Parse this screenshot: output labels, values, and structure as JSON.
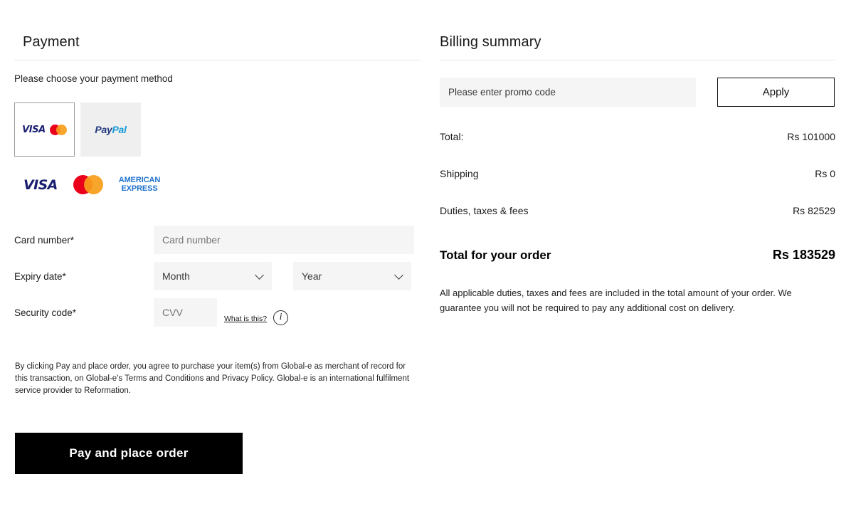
{
  "payment": {
    "title": "Payment",
    "choose_text": "Please choose your payment method",
    "methods": [
      {
        "id": "card",
        "label": "VISA",
        "label2": "Mastercard",
        "selected": true
      },
      {
        "id": "paypal",
        "label_part1": "Pay",
        "label_part2": "Pal",
        "selected": false
      }
    ],
    "accepted_brands": [
      {
        "name": "VISA"
      },
      {
        "name": "Mastercard"
      },
      {
        "name_line1": "AMERICAN",
        "name_line2": "EXPRESS"
      }
    ],
    "fields": {
      "card_number_label": "Card number",
      "card_number_required": "*",
      "card_number_placeholder": "Card number",
      "expiry_label": "Expiry date",
      "expiry_required": "*",
      "month_placeholder": "Month",
      "year_placeholder": "Year",
      "security_label": "Security code",
      "security_required": "*",
      "cvv_placeholder": "CVV",
      "what_is_this": "What is this?",
      "info_glyph": "i"
    },
    "legal_text": "By clicking Pay and place order, you agree to purchase your item(s) from Global-e as merchant of record for this transaction, on Global-e's Terms and Conditions and Privacy Policy. Global-e is an international fulfilment service provider to Reformation.",
    "submit_label": "Pay and place order"
  },
  "billing": {
    "title": "Billing summary",
    "promo_placeholder": "Please enter promo code",
    "promo_value": "",
    "apply_label": "Apply",
    "lines": [
      {
        "label": "Total:",
        "value": "Rs 101000"
      },
      {
        "label": "Shipping",
        "value": "Rs 0"
      },
      {
        "label": "Duties, taxes & fees",
        "value": "Rs 82529"
      }
    ],
    "order_total_label": "Total for your order",
    "order_total_value": "Rs 183529",
    "duties_note": "All applicable duties, taxes and fees are included in the total amount of your order. We guarantee you will not be required to pay any additional cost on delivery."
  },
  "colors": {
    "visa": "#1a1f71",
    "mastercard_red": "#eb001b",
    "mastercard_yellow": "#f79e1b",
    "amex_blue": "#1f72cd",
    "paypal_dark": "#253b80",
    "paypal_light": "#179bd7",
    "field_bg": "#f5f5f5",
    "button_bg": "#000000"
  }
}
